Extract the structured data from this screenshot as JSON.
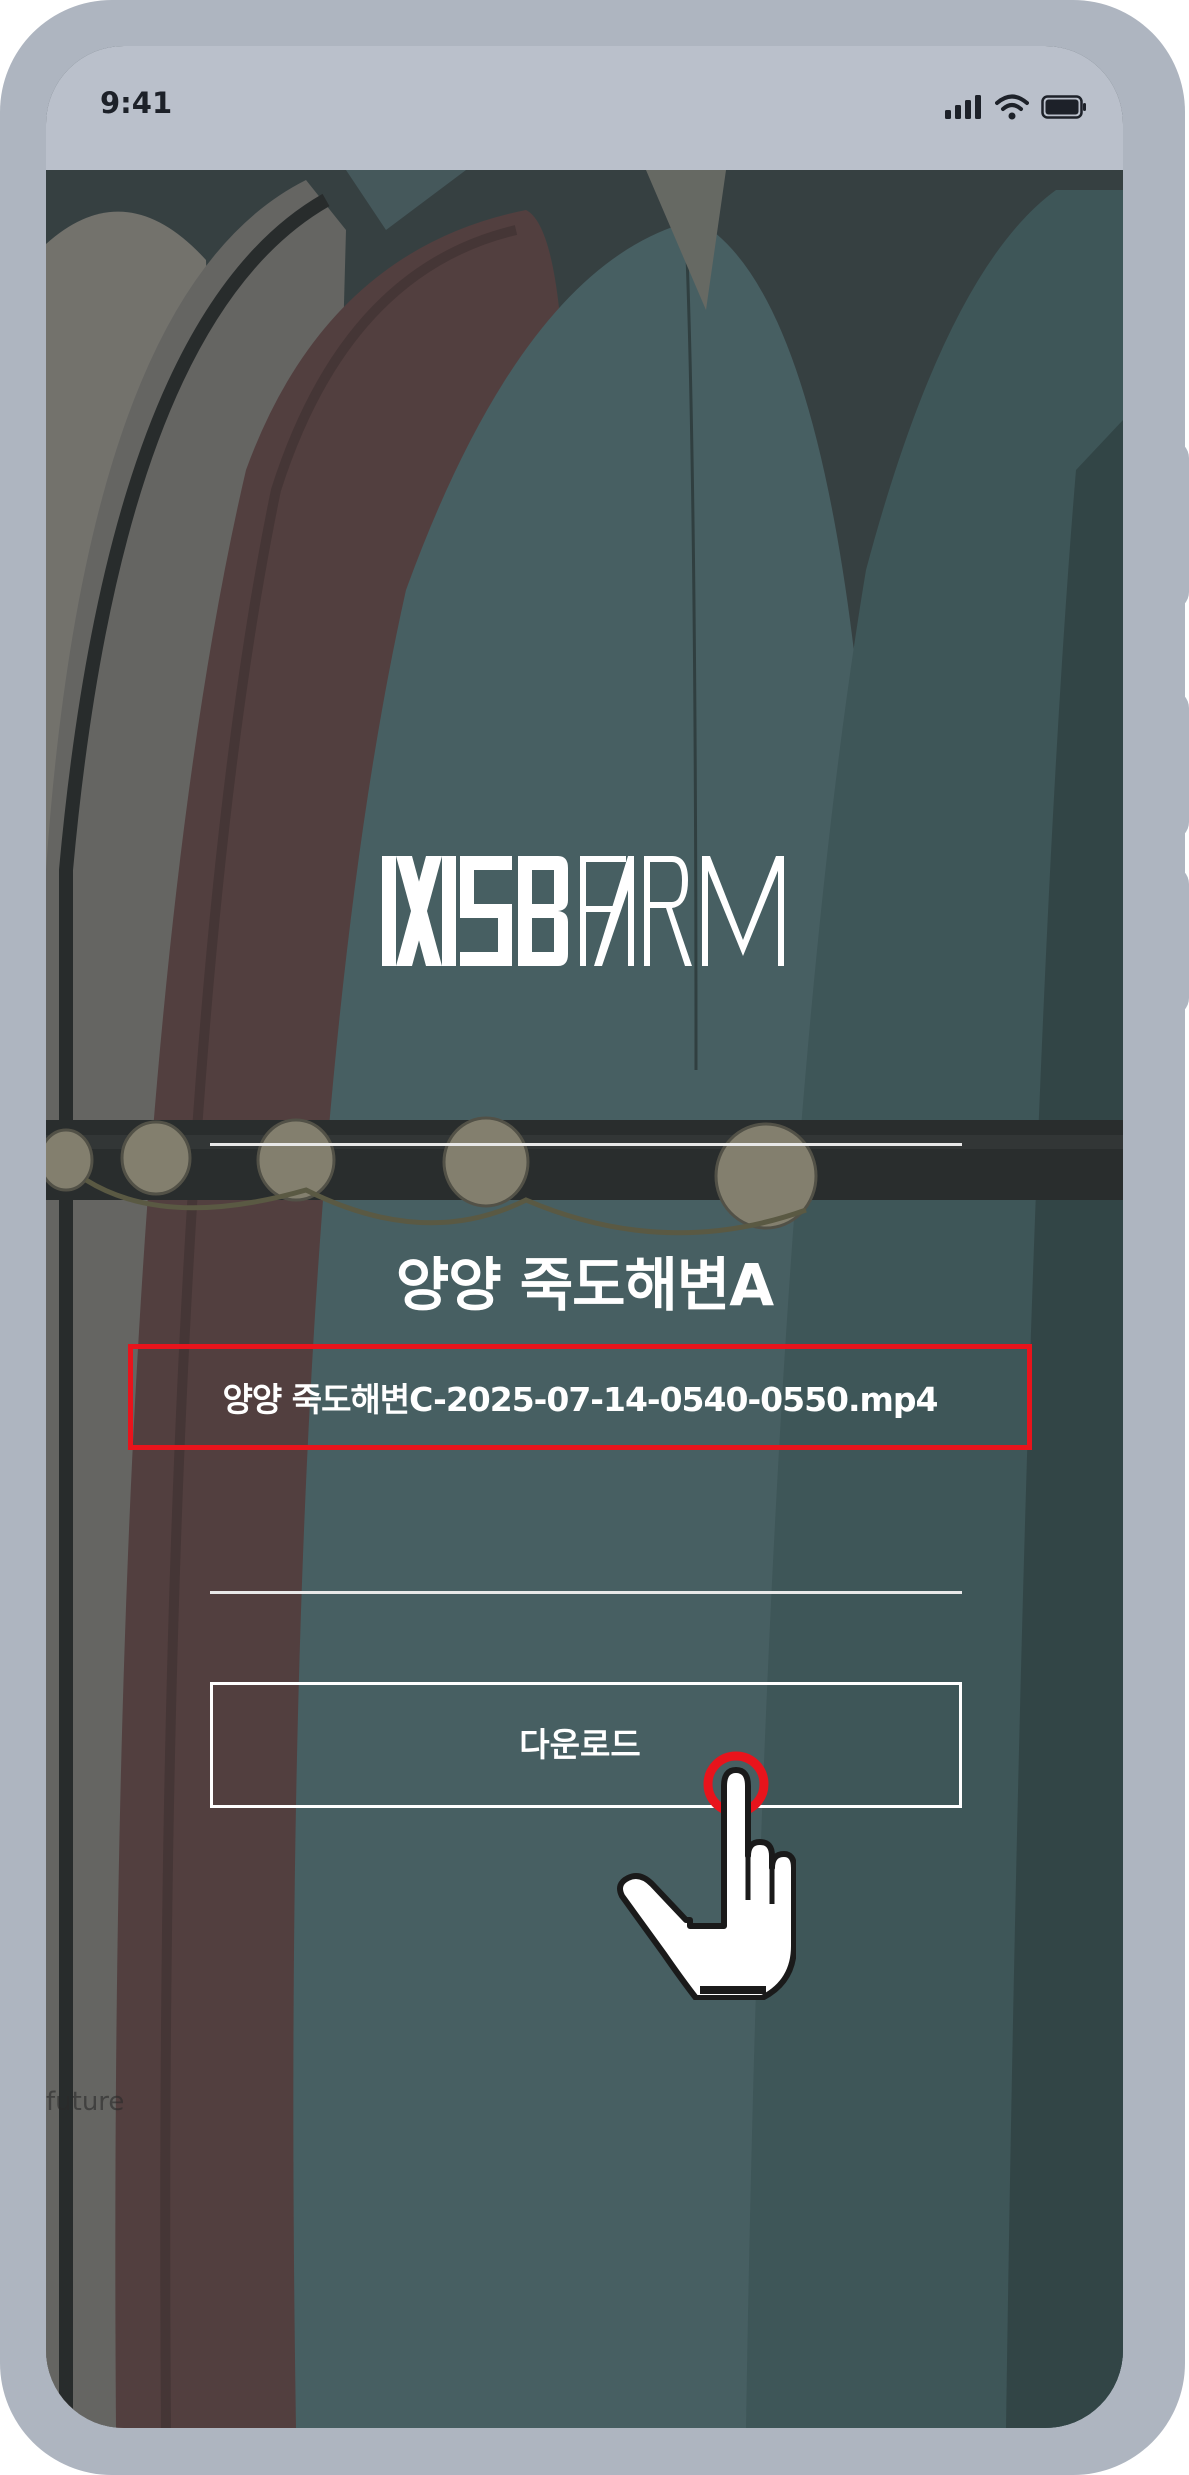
{
  "status_bar": {
    "time": "9:41"
  },
  "screen": {
    "brand_logo": "WSBFARM",
    "place_title": "양양 죽도해변A",
    "file_name": "양양 죽도해변C-2025-07-14-0540-0550.mp4",
    "download_label": "다운로드"
  },
  "colors": {
    "highlight_border": "#e8141c",
    "frame": "#aeb5c0",
    "status_bar": "#bac0cb"
  },
  "icons": [
    "signal-icon",
    "wifi-icon",
    "battery-icon",
    "hand-pointer-icon"
  ]
}
